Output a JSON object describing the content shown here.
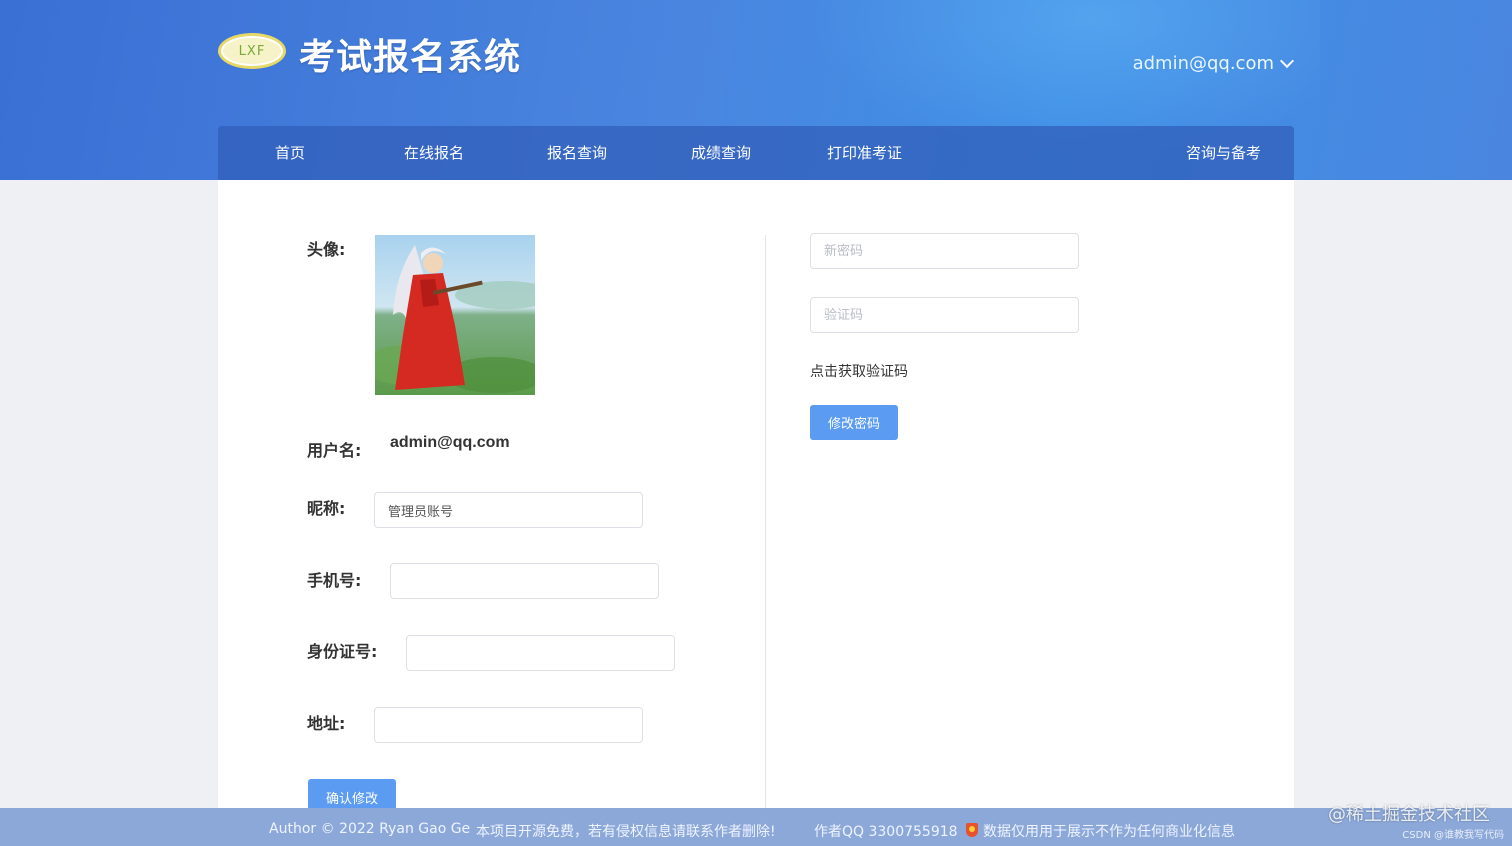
{
  "header": {
    "logo_text": "LXF",
    "title": "考试报名系统",
    "user": "admin@qq.com"
  },
  "nav": {
    "items": [
      "首页",
      "在线报名",
      "报名查询",
      "成绩查询",
      "打印准考证",
      "咨询与备考"
    ]
  },
  "profile": {
    "avatar_label": "头像:",
    "username_label": "用户名:",
    "username_value": "admin@qq.com",
    "nickname_label": "昵称:",
    "nickname_value": "管理员账号",
    "phone_label": "手机号:",
    "phone_value": "",
    "idcard_label": "身份证号:",
    "idcard_value": "",
    "address_label": "地址:",
    "address_value": "",
    "confirm_button": "确认修改"
  },
  "password": {
    "new_password_placeholder": "新密码",
    "code_placeholder": "验证码",
    "get_code_label": "点击获取验证码",
    "change_button": "修改密码"
  },
  "footer": {
    "author": "Author © 2022 Ryan Gao Ge",
    "opensource": "本项目开源免费，若有侵权信息请联系作者删除!",
    "qq": "作者QQ 3300755918",
    "disclaimer": "数据仅用用于展示不作为任何商业化信息"
  },
  "watermark": {
    "main": "@稀土掘金技术社区",
    "sub": "CSDN @谁教我写代码"
  }
}
